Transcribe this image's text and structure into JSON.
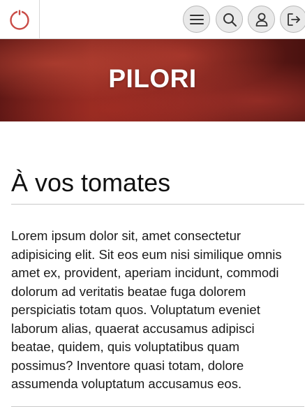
{
  "header": {
    "logo_icon": "power-circle-icon",
    "buttons": [
      {
        "icon": "menu-icon"
      },
      {
        "icon": "search-icon"
      },
      {
        "icon": "user-icon"
      },
      {
        "icon": "logout-icon"
      }
    ]
  },
  "hero": {
    "title": "PILORI"
  },
  "article": {
    "heading": "À vos tomates",
    "paragraph": "Lorem ipsum dolor sit, amet consectetur adipisicing elit. Sit eos eum nisi similique omnis amet ex, provident, aperiam incidunt, commodi dolorum ad veritatis beatae fuga dolorem perspiciatis totam quos. Voluptatum eveniet laborum alias, quaerat accusamus adipisci beatae, quidem, quis voluptatibus quam possimus? Inventore quasi totam, dolore assumenda voluptatum accusamus eos."
  },
  "colors": {
    "accent": "#c94a45",
    "hero_dark": "#5a1614",
    "button_bg": "#e9e9e9",
    "text": "#1a1a1a"
  }
}
